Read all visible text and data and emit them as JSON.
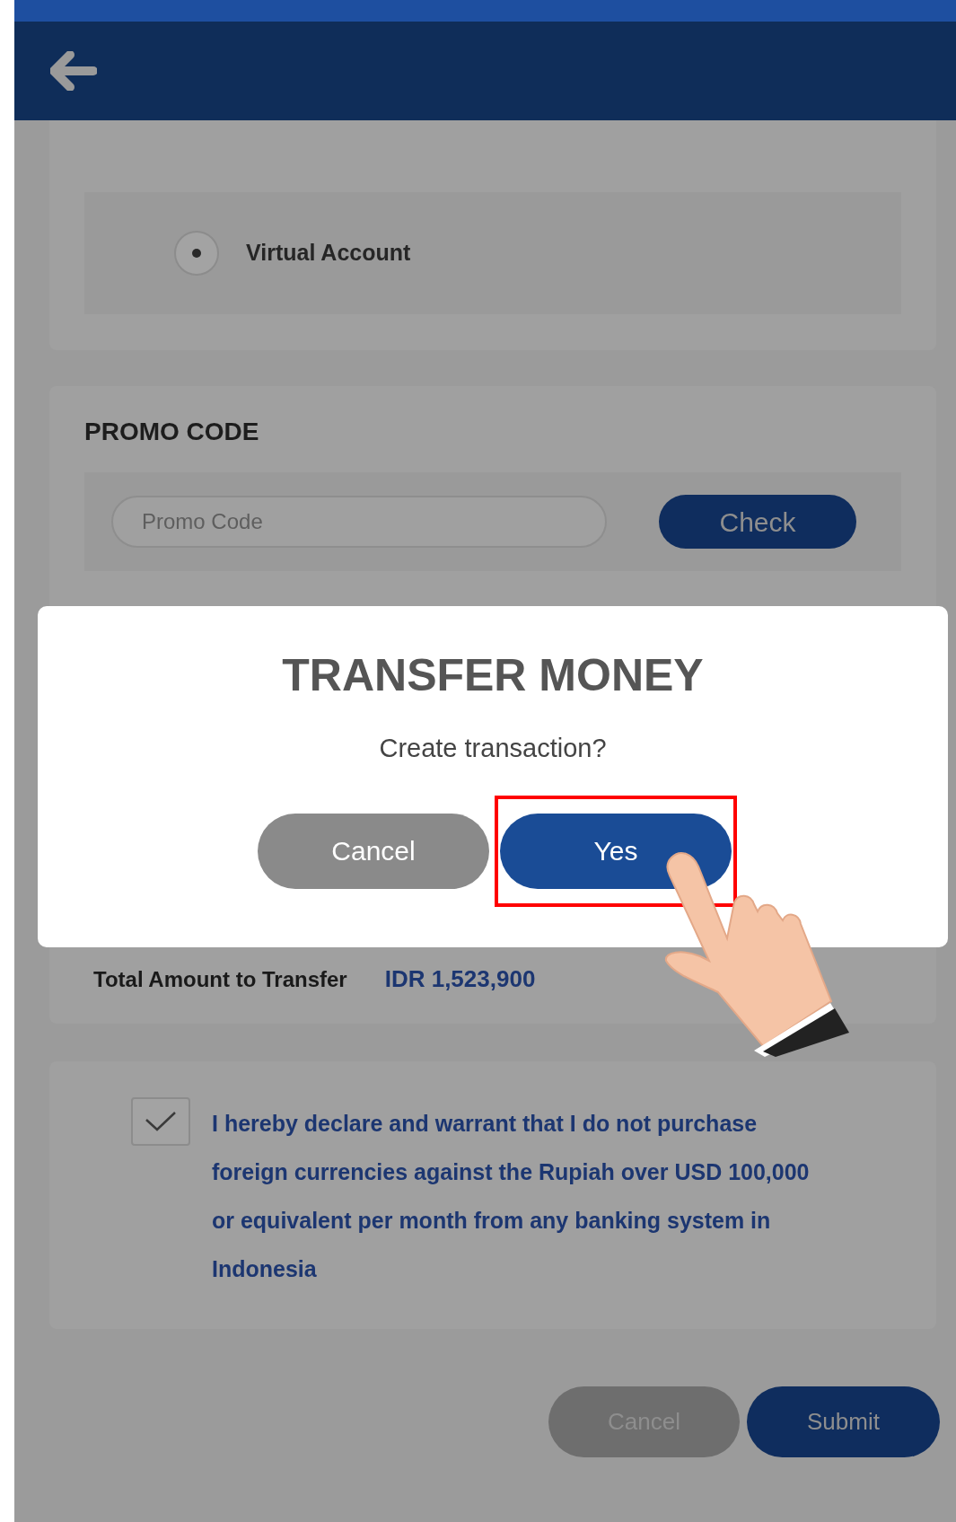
{
  "payment_methods": [
    {
      "label": "Virtual Account",
      "selected": true
    }
  ],
  "promo": {
    "title": "PROMO CODE",
    "placeholder": "Promo Code",
    "button": "Check"
  },
  "total": {
    "label": "Total Amount to Transfer",
    "value": "IDR 1,523,900"
  },
  "declaration": {
    "checked": true,
    "text": "I hereby declare and warrant that I do not purchase foreign currencies against the Rupiah over USD 100,000 or equivalent per month from any banking system in Indonesia"
  },
  "actions": [
    "Cancel",
    "Submit"
  ],
  "dialog": {
    "title": "TRANSFER MONEY",
    "message": "Create transaction?",
    "buttons": [
      {
        "label": "Cancel",
        "kind": "secondary",
        "highlighted": false
      },
      {
        "label": "Yes",
        "kind": "primary",
        "highlighted": true
      }
    ]
  }
}
